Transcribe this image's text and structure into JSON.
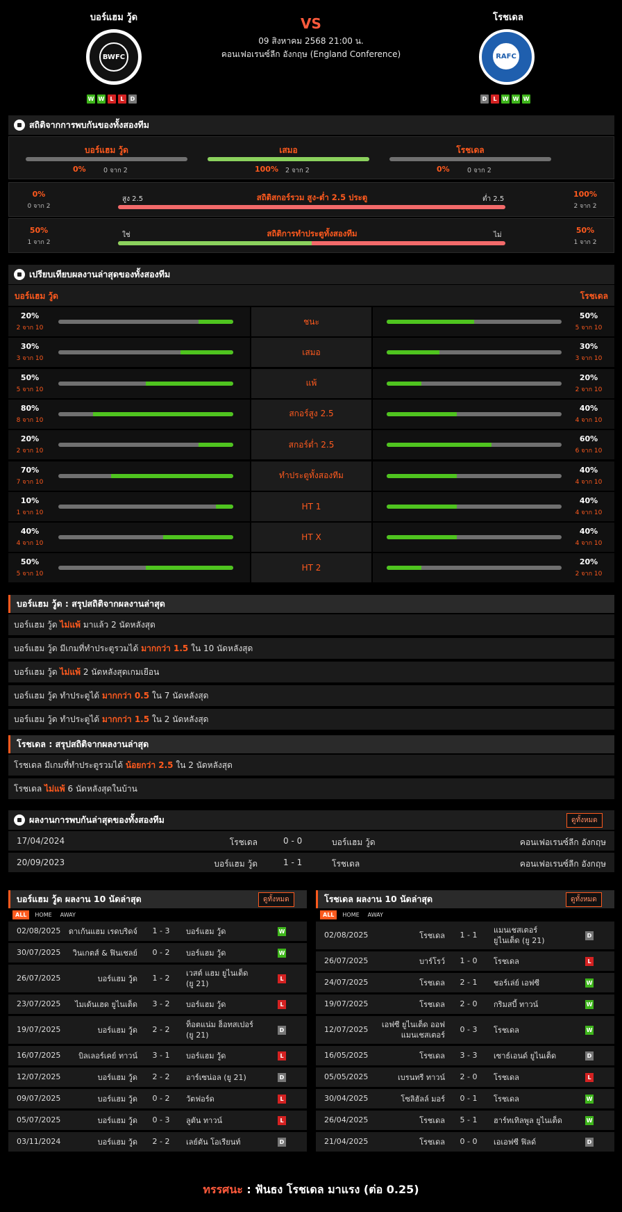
{
  "match": {
    "home": "บอร์แฮม วู้ด",
    "away": "โรชเดล",
    "vs": "VS",
    "date": "09 สิงหาคม 2568 21:00 น.",
    "league": "คอนเฟอเรนซ์ลีก อังกฤษ (England Conference)",
    "home_form": [
      "W",
      "W",
      "L",
      "L",
      "D"
    ],
    "away_form": [
      "D",
      "L",
      "W",
      "W",
      "W"
    ],
    "home_logo_text": "BWFC",
    "away_logo_text": "RAFC"
  },
  "h2h_stats": {
    "title": "สถิติจากการพบกันของทั้งสองทีม",
    "cols": [
      {
        "label": "บอร์แฮม วู้ด",
        "pct": "0%",
        "sub": "0 จาก 2",
        "value": 0
      },
      {
        "label": "เสมอ",
        "pct": "100%",
        "sub": "2 จาก 2",
        "value": 100
      },
      {
        "label": "โรชเดล",
        "pct": "0%",
        "sub": "0 จาก 2",
        "value": 0
      }
    ],
    "ou": {
      "title": "สถิติสกอร์รวม สูง-ต่ำ 2.5 ประตู",
      "left_label": "สูง 2.5",
      "right_label": "ต่ำ 2.5",
      "left_pct": "0%",
      "left_sub": "0 จาก 2",
      "right_pct": "100%",
      "right_sub": "2 จาก 2",
      "left_value": 0
    },
    "btts": {
      "title": "สถิติการทำประตูทั้งสองทีม",
      "left_label": "ใช่",
      "right_label": "ไม่",
      "left_pct": "50%",
      "left_sub": "1 จาก 2",
      "right_pct": "50%",
      "right_sub": "1 จาก 2",
      "left_value": 50
    }
  },
  "compare": {
    "title": "เปรียบเทียบผลงานล่าสุดของทั้งสองทีม",
    "home": "บอร์แฮม วู้ด",
    "away": "โรชเดล",
    "rows": [
      {
        "label": "ชนะ",
        "hp": "20%",
        "hs": "2 จาก 10",
        "hv": 20,
        "ap": "50%",
        "as": "5 จาก 10",
        "av": 50
      },
      {
        "label": "เสมอ",
        "hp": "30%",
        "hs": "3 จาก 10",
        "hv": 30,
        "ap": "30%",
        "as": "3 จาก 10",
        "av": 30
      },
      {
        "label": "แพ้",
        "hp": "50%",
        "hs": "5 จาก 10",
        "hv": 50,
        "ap": "20%",
        "as": "2 จาก 10",
        "av": 20
      },
      {
        "label": "สกอร์สูง 2.5",
        "hp": "80%",
        "hs": "8 จาก 10",
        "hv": 80,
        "ap": "40%",
        "as": "4 จาก 10",
        "av": 40
      },
      {
        "label": "สกอร์ต่ำ 2.5",
        "hp": "20%",
        "hs": "2 จาก 10",
        "hv": 20,
        "ap": "60%",
        "as": "6 จาก 10",
        "av": 60
      },
      {
        "label": "ทำประตูทั้งสองทีม",
        "hp": "70%",
        "hs": "7 จาก 10",
        "hv": 70,
        "ap": "40%",
        "as": "4 จาก 10",
        "av": 40
      },
      {
        "label": "HT 1",
        "hp": "10%",
        "hs": "1 จาก 10",
        "hv": 10,
        "ap": "40%",
        "as": "4 จาก 10",
        "av": 40
      },
      {
        "label": "HT X",
        "hp": "40%",
        "hs": "4 จาก 10",
        "hv": 40,
        "ap": "40%",
        "as": "4 จาก 10",
        "av": 40
      },
      {
        "label": "HT 2",
        "hp": "50%",
        "hs": "5 จาก 10",
        "hv": 50,
        "ap": "20%",
        "as": "2 จาก 10",
        "av": 20
      }
    ]
  },
  "home_summary": {
    "title": "บอร์แฮม วู้ด : สรุปสถิติจากผลงานล่าสุด",
    "rows": [
      [
        "บอร์แฮม วู้ด ",
        "ไม่แพ้",
        " มาแล้ว 2 นัดหลังสุด"
      ],
      [
        "บอร์แฮม วู้ด มีเกมที่ทำประตูรวมได้ ",
        "มากกว่า 1.5",
        " ใน 10 นัดหลังสุด"
      ],
      [
        "บอร์แฮม วู้ด ",
        "ไม่แพ้",
        " 2 นัดหลังสุดเกมเยือน"
      ],
      [
        "บอร์แฮม วู้ด ทำประตูได้ ",
        "มากกว่า 0.5",
        " ใน 7 นัดหลังสุด"
      ],
      [
        "บอร์แฮม วู้ด ทำประตูได้ ",
        "มากกว่า 1.5",
        " ใน 2 นัดหลังสุด"
      ]
    ]
  },
  "away_summary": {
    "title": "โรชเดล : สรุปสถิติจากผลงานล่าสุด",
    "rows": [
      [
        "โรชเดล มีเกมที่ทำประตูรวมได้ ",
        "น้อยกว่า 2.5",
        " ใน 2 นัดหลังสุด"
      ],
      [
        "โรชเดล ",
        "ไม่แพ้",
        " 6 นัดหลังสุดในบ้าน"
      ]
    ]
  },
  "h2h_results": {
    "title": "ผลงานการพบกันล่าสุดของทั้งสองทีม",
    "all_label": "ดูทั้งหมด",
    "rows": [
      {
        "date": "17/04/2024",
        "home": "โรชเดล",
        "score": "0 - 0",
        "away": "บอร์แฮม วู้ด",
        "comp": "คอนเฟอเรนซ์ลีก อังกฤษ"
      },
      {
        "date": "20/09/2023",
        "home": "บอร์แฮม วู้ด",
        "score": "1 - 1",
        "away": "โรชเดล",
        "comp": "คอนเฟอเรนซ์ลีก อังกฤษ"
      }
    ]
  },
  "tabs": [
    "ALL",
    "HOME",
    "AWAY"
  ],
  "home_last10": {
    "title": "บอร์แฮม วู้ด ผลงาน 10 นัดล่าสุด",
    "all_label": "ดูทั้งหมด",
    "rows": [
      {
        "date": "02/08/2025",
        "home": "ดาเก้นแฮม เรดบริดจ์",
        "score": "1 - 3",
        "away": "บอร์แฮม วู้ด",
        "res": "W"
      },
      {
        "date": "30/07/2025",
        "home": "วินเกตส์ & ฟินเชลย์",
        "score": "0 - 2",
        "away": "บอร์แฮม วู้ด",
        "res": "W"
      },
      {
        "date": "26/07/2025",
        "home": "บอร์แฮม วู้ด",
        "score": "1 - 2",
        "away": "เวสต์ แฮม ยูไนเต็ด (ยู 21)",
        "res": "L"
      },
      {
        "date": "23/07/2025",
        "home": "ไมเด้นเฮด ยูไนเต็ด",
        "score": "3 - 2",
        "away": "บอร์แฮม วู้ด",
        "res": "L"
      },
      {
        "date": "19/07/2025",
        "home": "บอร์แฮม วู้ด",
        "score": "2 - 2",
        "away": "ท็อตแน่ม ฮ็อทสเปอร์ (ยู 21)",
        "res": "D"
      },
      {
        "date": "16/07/2025",
        "home": "บิลเลอร์เคย์ ทาวน์",
        "score": "3 - 1",
        "away": "บอร์แฮม วู้ด",
        "res": "L"
      },
      {
        "date": "12/07/2025",
        "home": "บอร์แฮม วู้ด",
        "score": "2 - 2",
        "away": "อาร์เซน่อล (ยู 21)",
        "res": "D"
      },
      {
        "date": "09/07/2025",
        "home": "บอร์แฮม วู้ด",
        "score": "0 - 2",
        "away": "วัตฟอร์ด",
        "res": "L"
      },
      {
        "date": "05/07/2025",
        "home": "บอร์แฮม วู้ด",
        "score": "0 - 3",
        "away": "ลูตัน ทาวน์",
        "res": "L"
      },
      {
        "date": "03/11/2024",
        "home": "บอร์แฮม วู้ด",
        "score": "2 - 2",
        "away": "เลย์ตัน โอเรียนท์",
        "res": "D"
      }
    ]
  },
  "away_last10": {
    "title": "โรชเดล ผลงาน 10 นัดล่าสุด",
    "all_label": "ดูทั้งหมด",
    "rows": [
      {
        "date": "02/08/2025",
        "home": "โรชเดล",
        "score": "1 - 1",
        "away": "แมนเชสเตอร์ ยูไนเต็ด (ยู 21)",
        "res": "D"
      },
      {
        "date": "26/07/2025",
        "home": "บาร์โรว์",
        "score": "1 - 0",
        "away": "โรชเดล",
        "res": "L"
      },
      {
        "date": "24/07/2025",
        "home": "โรชเดล",
        "score": "2 - 1",
        "away": "ชอร์เล่ย์ เอฟซี",
        "res": "W"
      },
      {
        "date": "19/07/2025",
        "home": "โรชเดล",
        "score": "2 - 0",
        "away": "กริมสบี้ ทาวน์",
        "res": "W"
      },
      {
        "date": "12/07/2025",
        "home": "เอฟซี ยูไนเต็ด ออฟ แมนเชสเตอร์",
        "score": "0 - 3",
        "away": "โรชเดล",
        "res": "W"
      },
      {
        "date": "16/05/2025",
        "home": "โรชเดล",
        "score": "3 - 3",
        "away": "เซาธ์เอนด์ ยูไนเต็ด",
        "res": "D"
      },
      {
        "date": "05/05/2025",
        "home": "เบรนทรี ทาวน์",
        "score": "2 - 0",
        "away": "โรชเดล",
        "res": "L"
      },
      {
        "date": "30/04/2025",
        "home": "โซลิฮัลล์ มอร์",
        "score": "0 - 1",
        "away": "โรชเดล",
        "res": "W"
      },
      {
        "date": "26/04/2025",
        "home": "โรชเดล",
        "score": "5 - 1",
        "away": "ฮาร์ทเทิลพูล ยูไนเต็ด",
        "res": "W"
      },
      {
        "date": "21/04/2025",
        "home": "โรชเดล",
        "score": "0 - 0",
        "away": "เอเอฟซี ฟิลด์",
        "res": "D"
      }
    ]
  },
  "verdict": {
    "label": "ทรรศนะ",
    "sep": " : ",
    "text": "ฟันธง โรชเดล มาแรง (ต่อ 0.25)"
  }
}
